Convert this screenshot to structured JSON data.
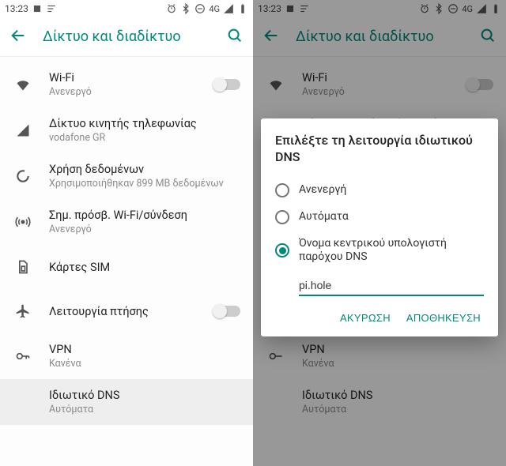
{
  "status": {
    "time": "13:23",
    "net": "4G"
  },
  "appbar": {
    "title": "Δίκτυο και διαδίκτυο"
  },
  "rows": {
    "wifi": {
      "title": "Wi-Fi",
      "sub": "Ανενεργό"
    },
    "mobile": {
      "title": "Δίκτυο κινητής τηλεφωνίας",
      "sub": "vodafone GR"
    },
    "datausage": {
      "title": "Χρήση δεδομένων",
      "sub": "Χρησιμοποιήθηκαν 899 MB δεδομένων"
    },
    "hotspot": {
      "title": "Σημ. πρόσβ. Wi-Fi/σύνδεση",
      "sub": "Ανενεργό"
    },
    "sim": {
      "title": "Κάρτες SIM"
    },
    "airplane": {
      "title": "Λειτουργία πτήσης"
    },
    "vpn": {
      "title": "VPN",
      "sub": "Κανένα"
    },
    "privdns": {
      "title": "Ιδιωτικό DNS",
      "sub": "Αυτόματα"
    }
  },
  "dialog": {
    "title": "Επιλέξτε τη λειτουργία ιδιωτικού DNS",
    "opt_off": "Ανενεργή",
    "opt_auto": "Αυτόματα",
    "opt_host": "Όνομα κεντρικού υπολογιστή παρόχου DNS",
    "hostname": "pi.hole",
    "cancel": "ΑΚΥΡΩΣΗ",
    "save": "ΑΠΟΘΗΚΕΥΣΗ"
  }
}
